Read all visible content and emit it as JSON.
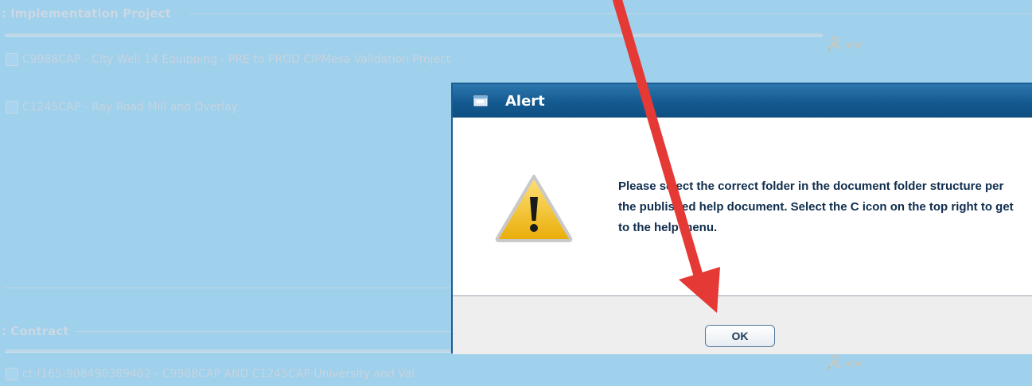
{
  "background": {
    "section1": {
      "prefix": ":",
      "title": "Implementation Project"
    },
    "section1_items": [
      {
        "label": "C9988CAP - City Well 14 Equipping - PRE to PROD CIPMesa Validation Project"
      },
      {
        "label": "C1245CAP - Ray Road Mill and Overlay"
      }
    ],
    "section2": {
      "prefix": ":",
      "title": "Contract"
    },
    "section2_items": [
      {
        "label": "ct-f165-908490389402 - C9988CAP AND C1245CAP University and Val"
      }
    ],
    "corner_icon_text": "<>"
  },
  "dialog": {
    "title": "Alert",
    "message": "Please select the correct folder in the document folder structure per the published help document. Select the C icon on the top right to get to the help menu.",
    "ok_label": "OK"
  },
  "colors": {
    "page_bg": "#9fd0ec",
    "dialog_title_bg": "#135a90",
    "annotation_arrow": "#e53935",
    "warning_yellow": "#f2c21a"
  },
  "icons": {
    "dialog_title": "window-icon",
    "dialog_body": "warning-triangle-icon",
    "corner": "user-link-icon"
  }
}
